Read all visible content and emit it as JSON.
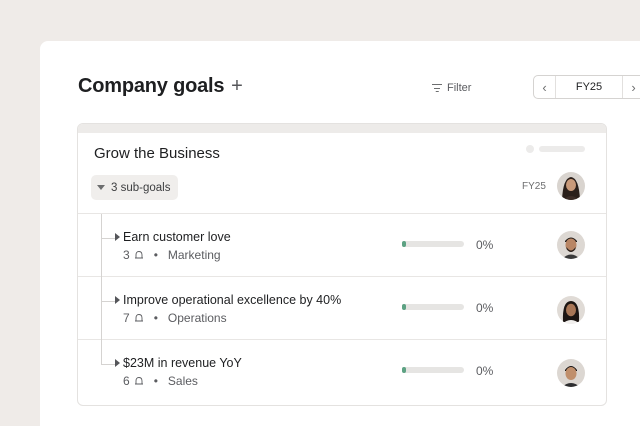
{
  "header": {
    "title": "Company goals",
    "add_symbol": "+",
    "filter_label": "Filter",
    "period": {
      "value": "FY25",
      "prev_symbol": "‹",
      "next_symbol": "›"
    }
  },
  "parent_goal": {
    "title": "Grow the Business",
    "subgoals_label": "3 sub-goals",
    "period": "FY25",
    "owner_avatar": "avatar-woman-long-hair"
  },
  "sub_goals": [
    {
      "title": "Earn customer love",
      "count": "3",
      "team": "Marketing",
      "progress": 0,
      "progress_label": "0%",
      "owner_avatar": "avatar-man-beard"
    },
    {
      "title": "Improve operational excellence by 40%",
      "count": "7",
      "team": "Operations",
      "progress": 0,
      "progress_label": "0%",
      "owner_avatar": "avatar-woman-dark-hair"
    },
    {
      "title": "$23M in revenue YoY",
      "count": "6",
      "team": "Sales",
      "progress": 0,
      "progress_label": "0%",
      "owner_avatar": "avatar-man-short-hair"
    }
  ],
  "separator": "•",
  "colors": {
    "background": "#efebe8",
    "progress_fill": "#5da283",
    "progress_track": "#e6e5e3"
  }
}
